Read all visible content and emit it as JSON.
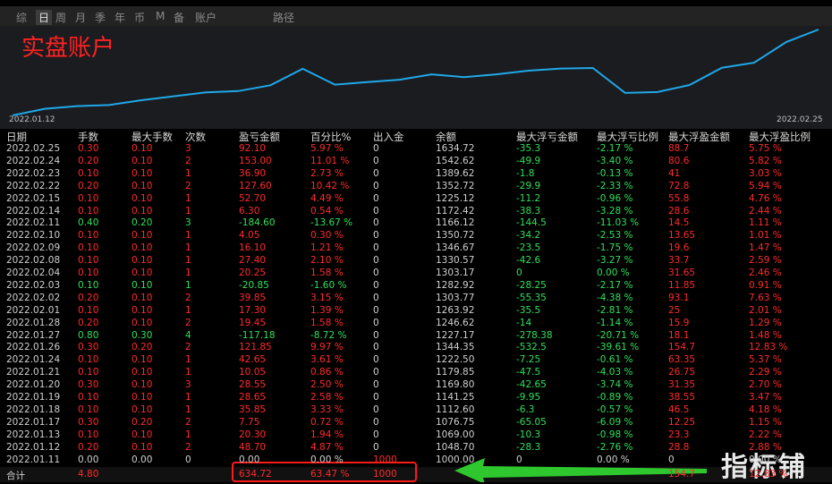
{
  "tabs": [
    "综",
    "日",
    "周",
    "月",
    "季",
    "年",
    "币",
    "M",
    "备",
    "账户",
    "路径"
  ],
  "active_tab": "日",
  "chart": {
    "title": "实盘账户",
    "start_date": "2022.01.12",
    "end_date": "2022.02.25",
    "line_color": "#20a8e8",
    "balance_series": [
      1000.0,
      1048.7,
      1069.0,
      1076.75,
      1112.6,
      1141.25,
      1169.8,
      1179.85,
      1222.5,
      1344.35,
      1227.17,
      1246.62,
      1263.92,
      1303.77,
      1282.92,
      1303.17,
      1330.57,
      1346.67,
      1350.72,
      1166.12,
      1172.42,
      1225.12,
      1352.72,
      1389.62,
      1542.62,
      1634.72
    ]
  },
  "headers": [
    "日期",
    "手数",
    "最大手数",
    "次数",
    "盈亏金额",
    "百分比%",
    "出入金",
    "余额",
    "最大浮亏金额",
    "最大浮亏比例",
    "最大浮盈金额",
    "最大浮盈比例"
  ],
  "rows": [
    {
      "c": [
        "2022.02.25",
        "0.30",
        "0.10",
        "3",
        "92.10",
        "5.97 %",
        "0",
        "1634.72",
        "-35.3",
        "-2.17 %",
        "88.7",
        "5.75 %"
      ],
      "k": "r"
    },
    {
      "c": [
        "2022.02.24",
        "0.20",
        "0.10",
        "2",
        "153.00",
        "11.01 %",
        "0",
        "1542.62",
        "-49.9",
        "-3.40 %",
        "80.6",
        "5.82 %"
      ],
      "k": "r"
    },
    {
      "c": [
        "2022.02.23",
        "0.10",
        "0.10",
        "1",
        "36.90",
        "2.73 %",
        "0",
        "1389.62",
        "-1.8",
        "-0.13 %",
        "41",
        "3.03 %"
      ],
      "k": "r"
    },
    {
      "c": [
        "2022.02.22",
        "0.20",
        "0.10",
        "2",
        "127.60",
        "10.42 %",
        "0",
        "1352.72",
        "-29.9",
        "-2.33 %",
        "72.8",
        "5.94 %"
      ],
      "k": "r"
    },
    {
      "c": [
        "2022.02.15",
        "0.10",
        "0.10",
        "1",
        "52.70",
        "4.49 %",
        "0",
        "1225.12",
        "-11.2",
        "-0.96 %",
        "55.8",
        "4.76 %"
      ],
      "k": "r"
    },
    {
      "c": [
        "2022.02.14",
        "0.10",
        "0.10",
        "1",
        "6.30",
        "0.54 %",
        "0",
        "1172.42",
        "-38.3",
        "-3.28 %",
        "28.6",
        "2.44 %"
      ],
      "k": "r"
    },
    {
      "c": [
        "2022.02.11",
        "0.40",
        "0.20",
        "3",
        "-184.60",
        "-13.67 %",
        "0",
        "1166.12",
        "-144.5",
        "-11.03 %",
        "14.5",
        "1.11 %"
      ],
      "k": "g"
    },
    {
      "c": [
        "2022.02.10",
        "0.10",
        "0.10",
        "1",
        "4.05",
        "0.30 %",
        "0",
        "1350.72",
        "-34.2",
        "-2.53 %",
        "13.65",
        "1.01 %"
      ],
      "k": "r"
    },
    {
      "c": [
        "2022.02.09",
        "0.10",
        "0.10",
        "1",
        "16.10",
        "1.21 %",
        "0",
        "1346.67",
        "-23.5",
        "-1.75 %",
        "19.6",
        "1.47 %"
      ],
      "k": "r"
    },
    {
      "c": [
        "2022.02.08",
        "0.10",
        "0.10",
        "1",
        "27.40",
        "2.10 %",
        "0",
        "1330.57",
        "-42.6",
        "-3.27 %",
        "33.7",
        "2.59 %"
      ],
      "k": "r"
    },
    {
      "c": [
        "2022.02.04",
        "0.10",
        "0.10",
        "1",
        "20.25",
        "1.58 %",
        "0",
        "1303.17",
        "0",
        "0.00 %",
        "31.65",
        "2.46 %"
      ],
      "k": "r"
    },
    {
      "c": [
        "2022.02.03",
        "0.10",
        "0.10",
        "1",
        "-20.85",
        "-1.60 %",
        "0",
        "1282.92",
        "-28.25",
        "-2.17 %",
        "11.85",
        "0.91 %"
      ],
      "k": "g"
    },
    {
      "c": [
        "2022.02.02",
        "0.20",
        "0.10",
        "2",
        "39.85",
        "3.15 %",
        "0",
        "1303.77",
        "-55.35",
        "-4.38 %",
        "93.1",
        "7.63 %"
      ],
      "k": "r"
    },
    {
      "c": [
        "2022.02.01",
        "0.10",
        "0.10",
        "1",
        "17.30",
        "1.39 %",
        "0",
        "1263.92",
        "-35.5",
        "-2.81 %",
        "25",
        "2.01 %"
      ],
      "k": "r"
    },
    {
      "c": [
        "2022.01.28",
        "0.20",
        "0.10",
        "2",
        "19.45",
        "1.58 %",
        "0",
        "1246.62",
        "-14",
        "-1.14 %",
        "15.9",
        "1.29 %"
      ],
      "k": "r"
    },
    {
      "c": [
        "2022.01.27",
        "0.80",
        "0.30",
        "4",
        "-117.18",
        "-8.72 %",
        "0",
        "1227.17",
        "-278.38",
        "-20.71 %",
        "18.1",
        "1.48 %"
      ],
      "k": "g"
    },
    {
      "c": [
        "2022.01.26",
        "0.30",
        "0.20",
        "2",
        "121.85",
        "9.97 %",
        "0",
        "1344.35",
        "-532.5",
        "-39.61 %",
        "154.7",
        "12.83 %"
      ],
      "k": "r"
    },
    {
      "c": [
        "2022.01.24",
        "0.10",
        "0.10",
        "1",
        "42.65",
        "3.61 %",
        "0",
        "1222.50",
        "-7.25",
        "-0.61 %",
        "63.35",
        "5.37 %"
      ],
      "k": "r"
    },
    {
      "c": [
        "2022.01.21",
        "0.10",
        "0.10",
        "1",
        "10.05",
        "0.86 %",
        "0",
        "1179.85",
        "-47.5",
        "-4.03 %",
        "26.75",
        "2.29 %"
      ],
      "k": "r"
    },
    {
      "c": [
        "2022.01.20",
        "0.30",
        "0.10",
        "3",
        "28.55",
        "2.50 %",
        "0",
        "1169.80",
        "-42.65",
        "-3.74 %",
        "31.35",
        "2.70 %"
      ],
      "k": "r"
    },
    {
      "c": [
        "2022.01.19",
        "0.10",
        "0.10",
        "1",
        "28.65",
        "2.58 %",
        "0",
        "1141.25",
        "-9.95",
        "-0.89 %",
        "38.55",
        "3.47 %"
      ],
      "k": "r"
    },
    {
      "c": [
        "2022.01.18",
        "0.10",
        "0.10",
        "1",
        "35.85",
        "3.33 %",
        "0",
        "1112.60",
        "-6.3",
        "-0.57 %",
        "46.5",
        "4.18 %"
      ],
      "k": "r"
    },
    {
      "c": [
        "2022.01.17",
        "0.30",
        "0.20",
        "2",
        "7.75",
        "0.72 %",
        "0",
        "1076.75",
        "-65.05",
        "-6.09 %",
        "12.25",
        "1.15 %"
      ],
      "k": "r"
    },
    {
      "c": [
        "2022.01.13",
        "0.10",
        "0.10",
        "1",
        "20.30",
        "1.94 %",
        "0",
        "1069.00",
        "-10.3",
        "-0.98 %",
        "23.3",
        "2.22 %"
      ],
      "k": "r"
    },
    {
      "c": [
        "2022.01.12",
        "0.20",
        "0.10",
        "2",
        "48.70",
        "4.87 %",
        "0",
        "1048.70",
        "-28.3",
        "-2.76 %",
        "28.8",
        "2.88 %"
      ],
      "k": "r"
    },
    {
      "c": [
        "2022.01.11",
        "0.00",
        "0.00",
        "0",
        "0.00",
        "0.00 %",
        "1000",
        "1000.00",
        "0",
        "0.00 %",
        "0",
        "0.00 %"
      ],
      "k": "w"
    }
  ],
  "total": {
    "label": "合计",
    "lots": "4.80",
    "profit": "634.72",
    "percent": "63.47 %",
    "deposit": "1000",
    "max_float_profit": "154.7",
    "max_float_profit_pct": "12.83 %"
  },
  "watermark": "指标铺",
  "colors": {
    "profit": "#ff2a2a",
    "loss": "#2fe05a",
    "highlight_box": "#ff1a1a",
    "arrow": "#2ec82e"
  }
}
